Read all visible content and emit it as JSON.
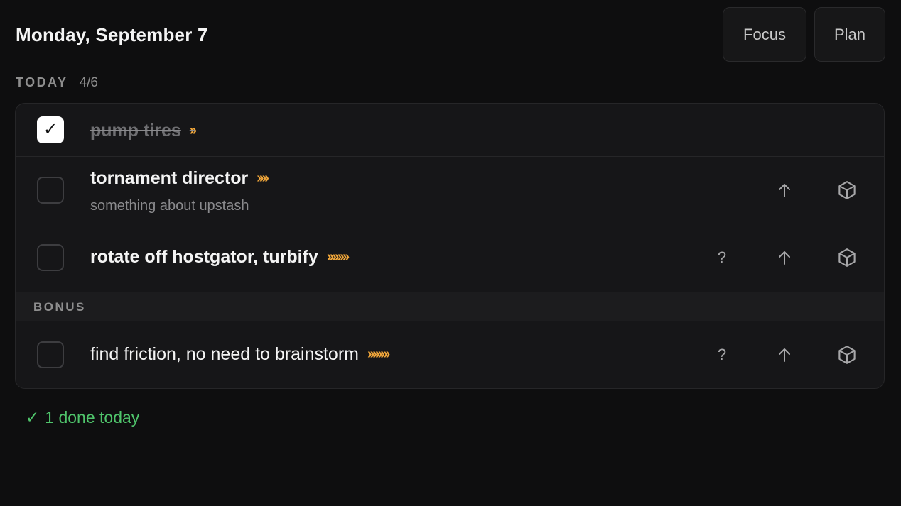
{
  "header": {
    "date": "Monday, September 7",
    "focus_label": "Focus",
    "plan_label": "Plan"
  },
  "today": {
    "label": "TODAY",
    "count": "4/6"
  },
  "tasks": [
    {
      "title": "pump tires",
      "chevrons": "››",
      "done": true,
      "subtitle": ""
    },
    {
      "title": "tornament director",
      "chevrons": "››››",
      "done": false,
      "subtitle": "something about upstash"
    },
    {
      "title": "rotate off hostgator, turbify",
      "chevrons": "››››››››",
      "done": false,
      "subtitle": ""
    }
  ],
  "bonus": {
    "label": "BONUS",
    "tasks": [
      {
        "title": "find friction, no need to brainstorm",
        "chevrons": "››››››››",
        "done": false
      }
    ]
  },
  "actions": {
    "question_glyph": "?"
  },
  "summary": {
    "check_glyph": "✓",
    "text": "1 done today"
  },
  "colors": {
    "background": "#0e0e0f",
    "card": "#161618",
    "chevron_accent": "#f0a63a",
    "done_green": "#4fc46b"
  },
  "icons": [
    "checkmark-icon",
    "arrow-up-icon",
    "cube-icon",
    "question-icon"
  ]
}
